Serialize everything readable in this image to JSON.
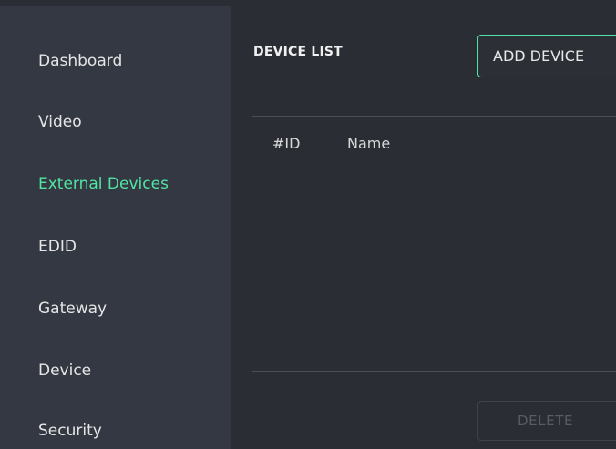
{
  "sidebar": {
    "items": [
      {
        "label": "Dashboard"
      },
      {
        "label": "Video"
      },
      {
        "label": "External Devices",
        "active": true
      },
      {
        "label": "EDID"
      },
      {
        "label": "Gateway"
      },
      {
        "label": "Device"
      },
      {
        "label": "Security"
      }
    ]
  },
  "main": {
    "title": "DEVICE LIST",
    "add_button_label": "ADD DEVICE",
    "table": {
      "columns": [
        "#ID",
        "Name"
      ],
      "rows": []
    },
    "delete_button_label": "DELETE"
  },
  "colors": {
    "accent": "#52e3a3",
    "sidebar_bg": "#343842",
    "main_bg": "#2a2d33"
  }
}
